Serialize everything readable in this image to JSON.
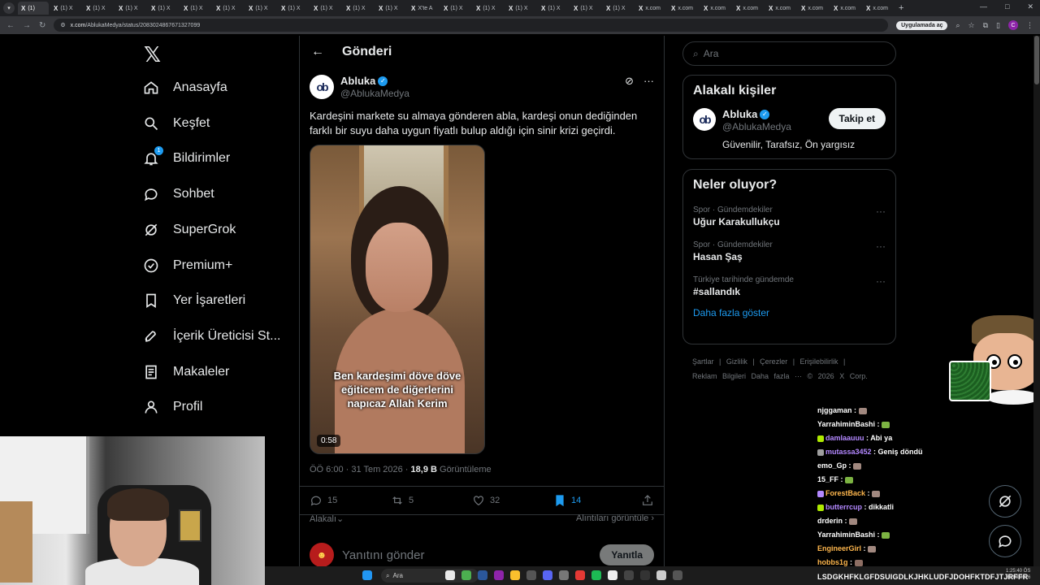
{
  "browser": {
    "tabs": [
      {
        "label": "(1)"
      },
      {
        "label": "(1) X"
      },
      {
        "label": "(1) X"
      },
      {
        "label": "(1) X"
      },
      {
        "label": "(1) X"
      },
      {
        "label": "(1) X"
      },
      {
        "label": "(1) X"
      },
      {
        "label": "(1) X"
      },
      {
        "label": "(1) X"
      },
      {
        "label": "(1) X"
      },
      {
        "label": "(1) X"
      },
      {
        "label": "(1) X"
      },
      {
        "label": "X'te A"
      },
      {
        "label": "(1) X"
      },
      {
        "label": "(1) X"
      },
      {
        "label": "(1) X"
      },
      {
        "label": "(1) X"
      },
      {
        "label": "(1) X"
      },
      {
        "label": "(1) X"
      },
      {
        "label": "x.com"
      },
      {
        "label": "x.com"
      },
      {
        "label": "x.com"
      },
      {
        "label": "x.com"
      },
      {
        "label": "x.com"
      },
      {
        "label": "x.com"
      },
      {
        "label": "x.com"
      },
      {
        "label": "x.com"
      }
    ],
    "url_host": "x.com",
    "url_path": "/AblukaMedya/status/2083024867671327099",
    "app_pill": "Uygulamada aç",
    "profile_initial": "C"
  },
  "nav": {
    "items": [
      {
        "label": "Anasayfa",
        "icon": "home-icon"
      },
      {
        "label": "Keşfet",
        "icon": "search-icon"
      },
      {
        "label": "Bildirimler",
        "icon": "bell-icon",
        "badge": "1"
      },
      {
        "label": "Sohbet",
        "icon": "chat-icon"
      },
      {
        "label": "SuperGrok",
        "icon": "grok-icon"
      },
      {
        "label": "Premium+",
        "icon": "premium-icon"
      },
      {
        "label": "Yer İşaretleri",
        "icon": "bookmark-icon"
      },
      {
        "label": "İçerik Üreticisi St...",
        "icon": "rocket-icon"
      },
      {
        "label": "Makaleler",
        "icon": "article-icon"
      },
      {
        "label": "Profil",
        "icon": "profile-icon"
      }
    ]
  },
  "main": {
    "title": "Gönderi",
    "post": {
      "author_name": "Abluka",
      "author_handle": "@AblukaMedya",
      "text": "Kardeşini markete su almaya gönderen abla, kardeşi onun dediğinden farklı bir suyu daha uygun fiyatlı bulup aldığı için sinir krizi geçirdi.",
      "video_caption_1": "Ben kardeşimi döve döve",
      "video_caption_2": "eğiticem de diğerlerini",
      "video_caption_3": "napıcaz Allah Kerim",
      "duration": "0:58",
      "time": "ÖÖ 6:00 · 31 Tem 2026 · ",
      "views": "18,9 B",
      "views_label": " Görüntüleme",
      "replies": "15",
      "reposts": "5",
      "likes": "32",
      "bookmarks": "14",
      "related_label": "Alakalı",
      "quotes_label": "Alıntıları görüntüle"
    },
    "reply": {
      "placeholder": "Yanıtını gönder",
      "button": "Yanıtla"
    }
  },
  "right": {
    "search_placeholder": "Ara",
    "relevant": {
      "title": "Alakalı kişiler",
      "name": "Abluka",
      "handle": "@AblukaMedya",
      "bio": "Güvenilir, Tarafsız, Ön yargısız",
      "follow": "Takip et"
    },
    "trends": {
      "title": "Neler oluyor?",
      "items": [
        {
          "category": "Spor · Gündemdekiler",
          "name": "Uğur Karakullukçu"
        },
        {
          "category": "Spor · Gündemdekiler",
          "name": "Hasan Şaş"
        },
        {
          "category": "Türkiye tarihinde gündemde",
          "name": "#sallandık"
        }
      ],
      "show_more": "Daha fazla göster"
    },
    "footer": {
      "line1": "Şartlar | Gizlilik | Çerezler | Erişilebilirlik |",
      "line2": "Reklam Bilgileri   Daha fazla ···   © 2026 X Corp."
    }
  },
  "chat": {
    "lines": [
      {
        "user": "njggaman",
        "msg": "",
        "color": "#ffffff",
        "sub": ""
      },
      {
        "user": "YarrahiminBashi",
        "msg": "",
        "color": "#ffffff",
        "sub": ""
      },
      {
        "user": "damlaauuu",
        "msg": "Abi ya",
        "color": "#b388ff",
        "sub": "#aeea00"
      },
      {
        "user": "mutassa3452",
        "msg": "Geniş döndü",
        "color": "#b388ff",
        "sub": "#9e9e9e"
      },
      {
        "user": "emo_Gp",
        "msg": "",
        "color": "#ffffff",
        "sub": ""
      },
      {
        "user": "15_FF",
        "msg": "",
        "color": "#ffffff",
        "sub": ""
      },
      {
        "user": "ForestBack",
        "msg": "",
        "color": "#ffb74d",
        "sub": "#b388ff"
      },
      {
        "user": "butterrcup",
        "msg": "dikkatli",
        "color": "#b388ff",
        "sub": "#aeea00"
      },
      {
        "user": "drderin",
        "msg": "",
        "color": "#ffffff",
        "sub": ""
      },
      {
        "user": "YarrahiminBashi",
        "msg": "",
        "color": "#ffffff",
        "sub": ""
      },
      {
        "user": "EngineerGirl",
        "msg": "",
        "color": "#ffb74d",
        "sub": ""
      },
      {
        "user": "hobbs1g",
        "msg": "",
        "color": "#ffb74d",
        "sub": ""
      }
    ],
    "marquee": "LSDGKHFKLGFDSUIGDLKJHKLUDFJDOHFKTDFJTJRFFR"
  },
  "taskbar": {
    "search": "Ara",
    "time": "1:25:40 ÖS",
    "date": "31.08.2026"
  },
  "colors": {
    "accent": "#1d9bf0",
    "background": "#000000",
    "border": "#2f3336",
    "muted": "#71767b"
  }
}
